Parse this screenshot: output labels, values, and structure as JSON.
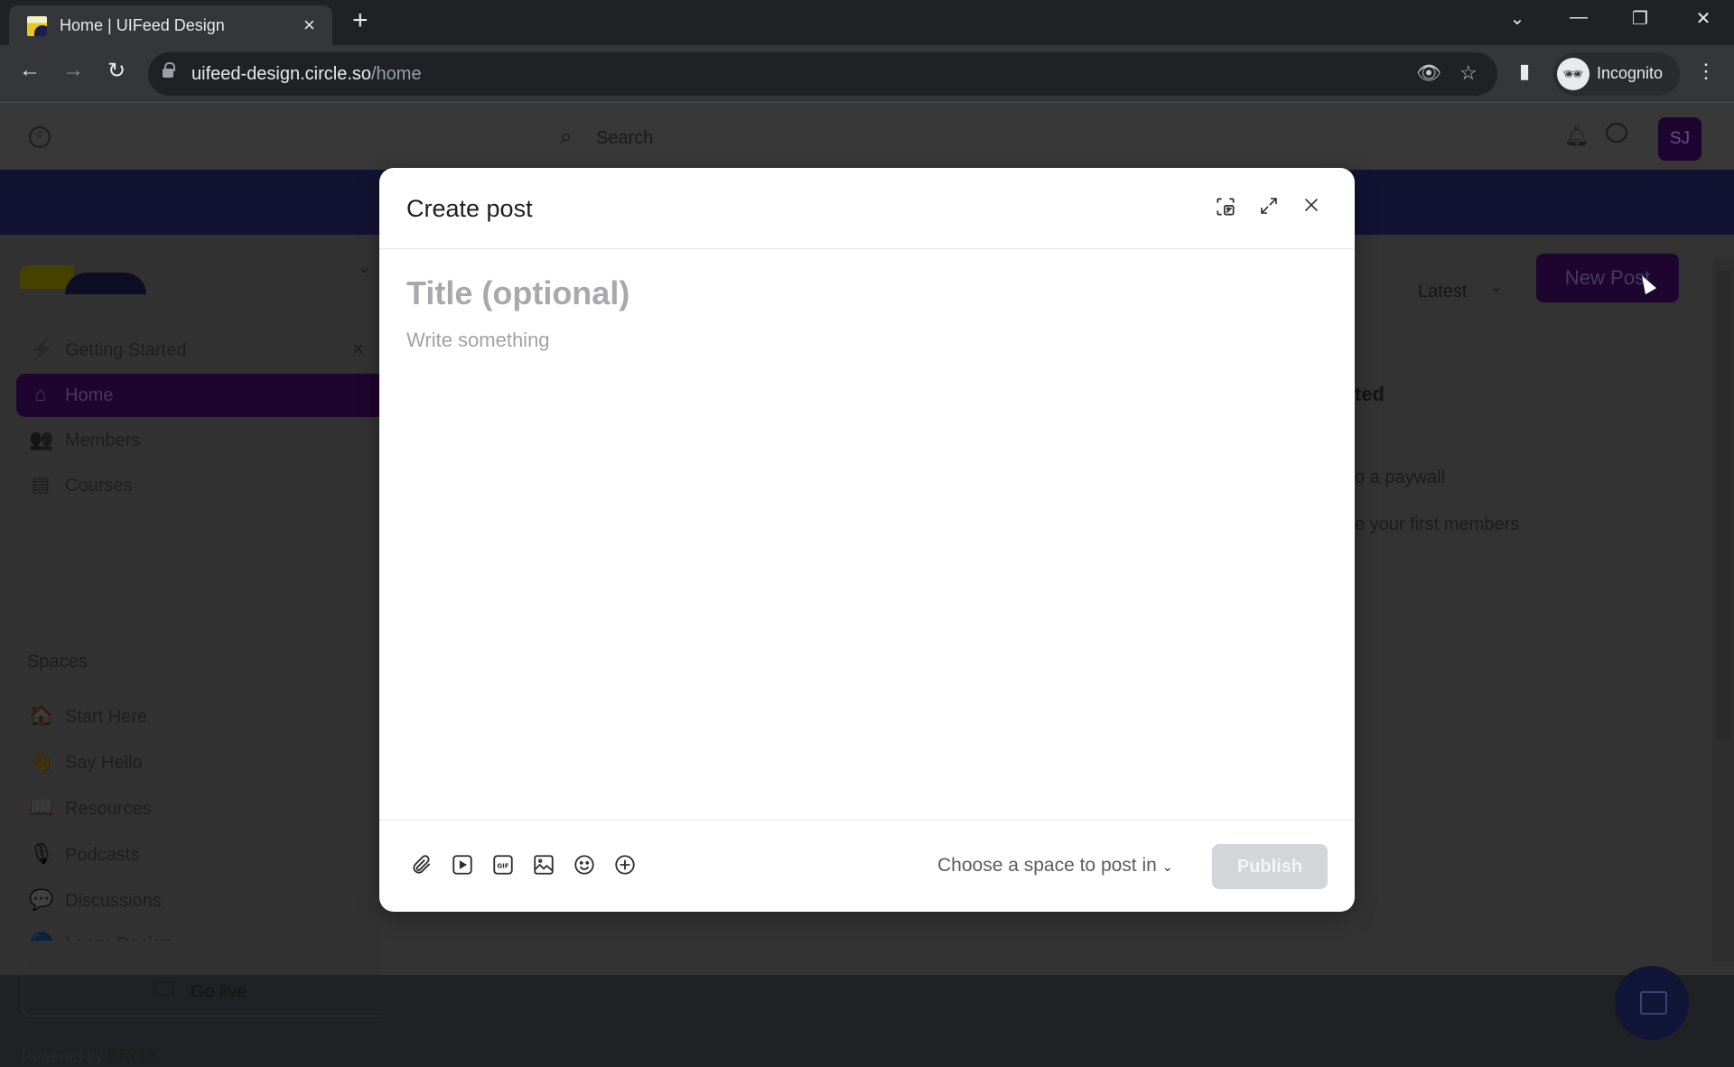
{
  "browser": {
    "tab_title": "Home | UIFeed Design",
    "tab_close": "×",
    "new_tab": "+",
    "url_host": "uifeed-design.circle.so",
    "url_path": "/home",
    "profile_label": "Incognito",
    "window_controls": {
      "dropdown": "⌄",
      "minimize": "—",
      "restore": "❐",
      "close": "✕"
    },
    "nav": {
      "back": "←",
      "forward": "→",
      "reload": "↻"
    },
    "icons": {
      "eye_off": "👁",
      "star": "☆",
      "side_panel": "▮",
      "menu": "⋮"
    }
  },
  "app_header": {
    "search_placeholder": "Search",
    "avatar_initials": "SJ",
    "bell_icon": "🔔"
  },
  "sidebar": {
    "nav_items": [
      {
        "label": "Getting Started",
        "icon": "⚡",
        "dismiss": "×"
      },
      {
        "label": "Home",
        "icon": "⌂",
        "active": true
      },
      {
        "label": "Members",
        "icon": "👥"
      },
      {
        "label": "Courses",
        "icon": "▤"
      }
    ],
    "spaces_heading": "Spaces",
    "spaces": [
      {
        "label": "Start Here",
        "icon": "🏠"
      },
      {
        "label": "Say Hello",
        "icon": "👋"
      },
      {
        "label": "Resources",
        "icon": "📖"
      },
      {
        "label": "Podcasts",
        "icon": "🎙"
      },
      {
        "label": "Discussions",
        "icon": "💬"
      },
      {
        "label": "Learn Design",
        "icon": "🔵"
      }
    ],
    "go_live_label": "Go live",
    "powered_by": "Powered by",
    "powered_brand": "Circle",
    "chevron": "⌄"
  },
  "feed": {
    "sort_label": "Latest",
    "sort_chevron": "⌄",
    "new_post_label": "New Post",
    "getting_started_partial": "ted",
    "checklist_partial_1": "o a paywall",
    "checklist_partial_2": "e your first members"
  },
  "modal": {
    "title": "Create post",
    "header_icons": {
      "cover_image": "⧉",
      "expand": "⤢",
      "close": "✕"
    },
    "title_placeholder": "Title (optional)",
    "body_placeholder": "Write something",
    "toolbar_icons": [
      "attachment-icon",
      "video-icon",
      "gif-icon",
      "image-icon",
      "emoji-icon",
      "add-icon"
    ],
    "space_select_label": "Choose a space to post in",
    "space_select_chevron": "⌄",
    "publish_label": "Publish"
  },
  "colors": {
    "brand_purple": "#1e0530",
    "banner_navy": "#121333",
    "publish_disabled": "#d4d5d8"
  }
}
